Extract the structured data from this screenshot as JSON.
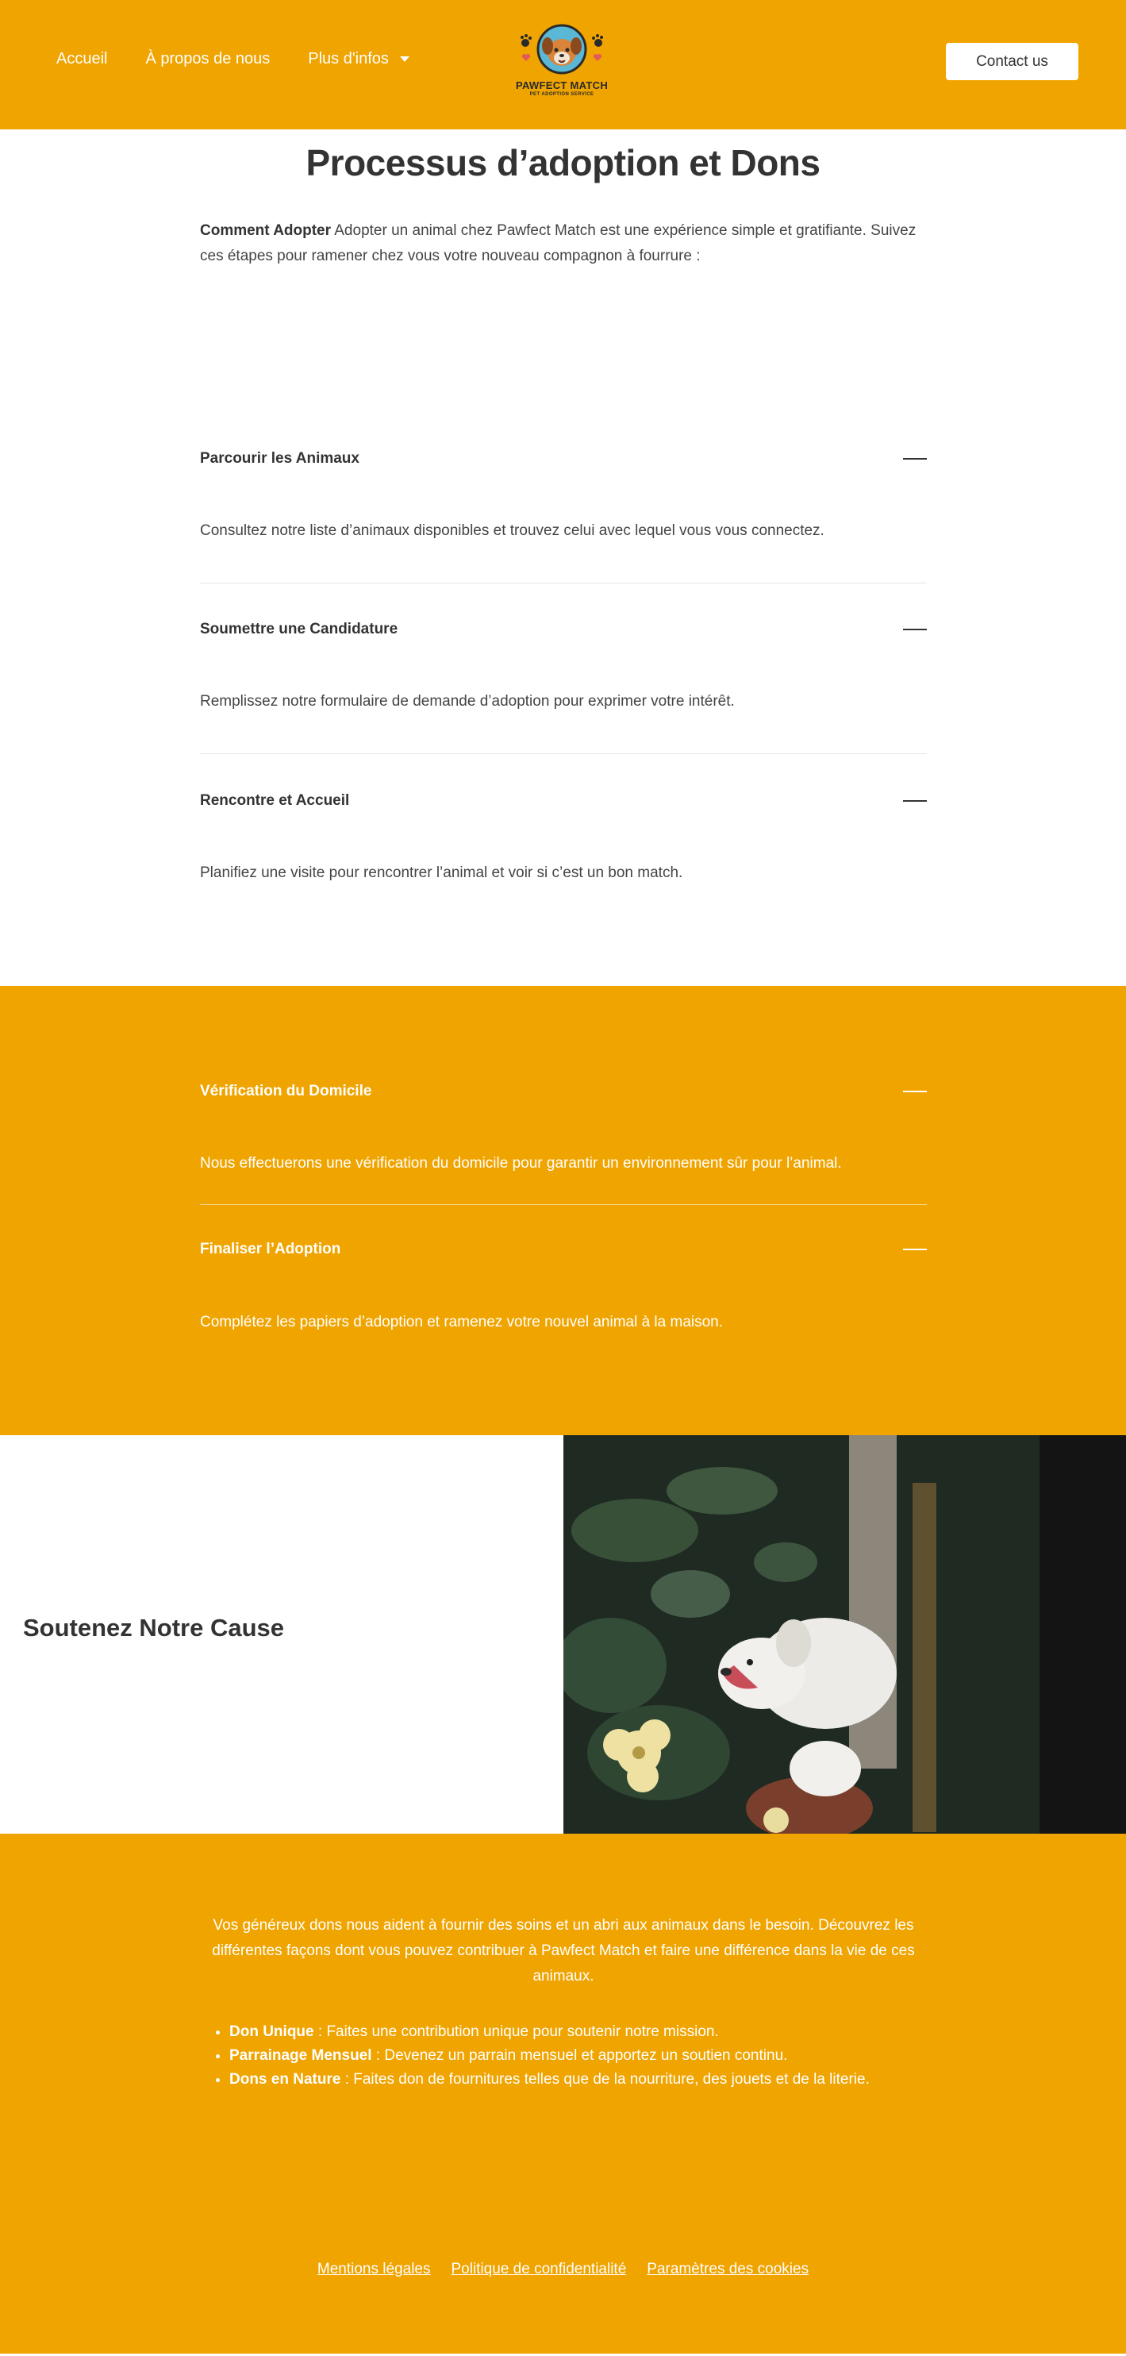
{
  "header": {
    "nav": [
      {
        "label": "Accueil"
      },
      {
        "label": "À propos de nous"
      },
      {
        "label": "Plus d'infos"
      }
    ],
    "logo": {
      "title": "PAWFECT MATCH",
      "tagline": "PET ADOPTION SERVICE"
    },
    "contact_label": "Contact us"
  },
  "adoption": {
    "title": "Processus d’adoption et Dons",
    "intro_bold": "Comment Adopter",
    "intro_text": " Adopter un animal chez Pawfect Match est une expérience simple et gratifiante. Suivez ces étapes pour ramener chez vous votre nouveau compagnon à fourrure :",
    "steps": [
      {
        "title": "Parcourir les Animaux",
        "body": " Consultez notre liste d’animaux disponibles et trouvez celui avec lequel vous vous connectez."
      },
      {
        "title": " Soumettre une Candidature",
        "body": "Remplissez notre formulaire de demande d’adoption pour exprimer votre intérêt."
      },
      {
        "title": " Rencontre et Accueil",
        "body": "Planifiez une visite pour rencontrer l’animal et voir si c’est un bon match."
      },
      {
        "title": "Vérification du Domicile",
        "body": "Nous effectuerons une vérification du domicile pour garantir un environnement sûr pour l’animal."
      },
      {
        "title": " Finaliser l’Adoption",
        "body": "Complétez les papiers d’adoption et ramenez votre nouvel animal à la maison."
      }
    ]
  },
  "support": {
    "title": "Soutenez Notre Cause"
  },
  "donations": {
    "text": "Vos généreux dons nous aident à fournir des soins et un abri aux animaux dans le besoin. Découvrez les différentes façons dont vous pouvez contribuer à Pawfect Match et faire une différence dans la vie de ces animaux.",
    "items": [
      {
        "bold": "Don Unique",
        "text": " : Faites une contribution unique pour soutenir notre mission."
      },
      {
        "bold": "Parrainage Mensuel",
        "text": " : Devenez un parrain mensuel et apportez un soutien continu."
      },
      {
        "bold": "Dons en Nature",
        "text": " : Faites don de fournitures telles que de la nourriture, des jouets et de la literie."
      }
    ]
  },
  "footer": {
    "links": [
      {
        "label": "Mentions légales"
      },
      {
        "label": "Politique de confidentialité"
      },
      {
        "label": "Paramètres des cookies"
      }
    ]
  },
  "colors": {
    "brand": "#f0a400",
    "text": "#333333",
    "white": "#ffffff"
  }
}
